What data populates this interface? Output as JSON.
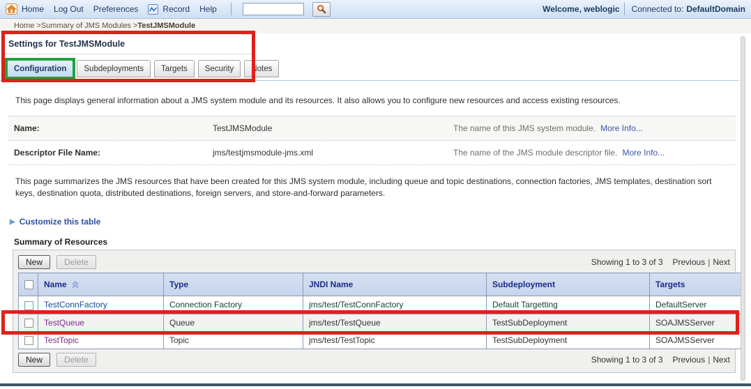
{
  "colors": {
    "topbar_bg": "#d9e6f6",
    "annotation_red": "#de211b",
    "annotation_green": "#1fa33c",
    "link_blue": "#2b3c9c",
    "link_visited_purple": "#822b8a",
    "table_header_bg": "#ccd9ee",
    "table_header_text": "#1b2c8a",
    "footer_bar": "#3d5866",
    "home_icon_orange": "#e8922f"
  },
  "topbar": {
    "links": [
      "Home",
      "Log Out",
      "Preferences"
    ],
    "record_label": "Record",
    "help_label": "Help",
    "search": {
      "value": "",
      "placeholder": ""
    },
    "welcome": "Welcome, weblogic",
    "connected_label": "Connected to:",
    "connected_value": "DefaultDomain"
  },
  "breadcrumb": {
    "separator": ">",
    "links": [
      "Home",
      "Summary of JMS Modules"
    ],
    "current": "TestJMSModule"
  },
  "settings": {
    "title": "Settings for TestJMSModule",
    "tabs": [
      {
        "label": "Configuration",
        "active": true
      },
      {
        "label": "Subdeployments",
        "active": false
      },
      {
        "label": "Targets",
        "active": false
      },
      {
        "label": "Security",
        "active": false
      },
      {
        "label": "Notes",
        "active": false
      }
    ]
  },
  "intro_text": "This page displays general information about a JMS system module and its resources. It also allows you to configure new resources and access existing resources.",
  "properties": [
    {
      "label": "Name:",
      "value": "TestJMSModule",
      "help": "The name of this JMS system module.",
      "more_info": "More Info..."
    },
    {
      "label": "Descriptor File Name:",
      "value": "jms/testjmsmodule-jms.xml",
      "help": "The name of the JMS module descriptor file.",
      "more_info": "More Info..."
    }
  ],
  "summary_text": "This page summarizes the JMS resources that have been created for this JMS system module, including queue and topic destinations, connection factories, JMS templates, destination sort keys, destination quota, distributed destinations, foreign servers, and store-and-forward parameters.",
  "customize_link": "Customize this table",
  "resources": {
    "heading": "Summary of Resources",
    "new_button": "New",
    "delete_button": "Delete",
    "paging": {
      "showing": "Showing 1 to 3 of 3",
      "previous": "Previous",
      "separator": "|",
      "next": "Next"
    },
    "columns": [
      "Name",
      "Type",
      "JNDI Name",
      "Subdeployment",
      "Targets"
    ],
    "rows": [
      {
        "name": "TestConnFactory",
        "type": "Connection Factory",
        "jndi_name": "jms/test/TestConnFactory",
        "subdeployment": "Default Targetting",
        "targets": "DefaultServer",
        "visited": false,
        "highlighted": false
      },
      {
        "name": "TestQueue",
        "type": "Queue",
        "jndi_name": "jms/test/TestQueue",
        "subdeployment": "TestSubDeployment",
        "targets": "SOAJMSServer",
        "visited": true,
        "highlighted": true
      },
      {
        "name": "TestTopic",
        "type": "Topic",
        "jndi_name": "jms/test/TestTopic",
        "subdeployment": "TestSubDeployment",
        "targets": "SOAJMSServer",
        "visited": true,
        "highlighted": false
      }
    ]
  },
  "annotations": [
    {
      "shape": "rectangle",
      "color": "red",
      "around": "Settings for TestJMSModule title and tab bar"
    },
    {
      "shape": "rectangle",
      "color": "green",
      "around": "Configuration tab"
    },
    {
      "shape": "rectangle",
      "color": "red",
      "around": "TestQueue table row"
    }
  ]
}
